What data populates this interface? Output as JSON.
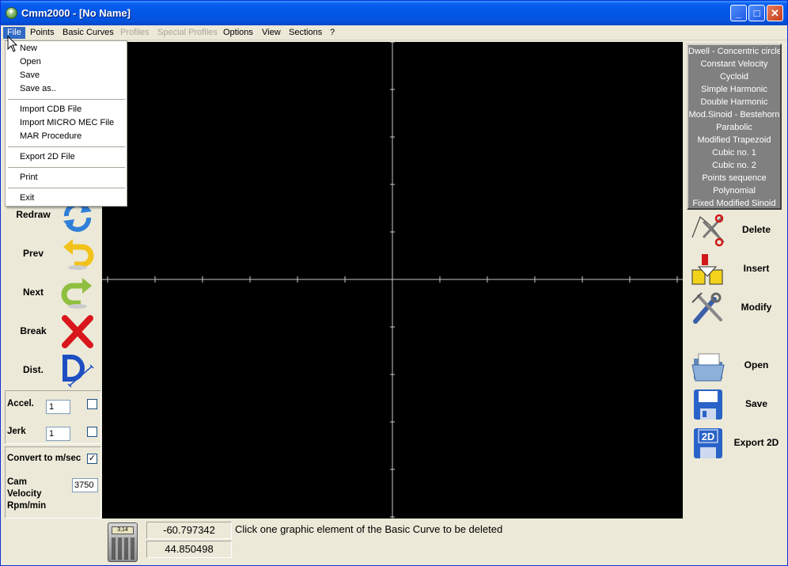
{
  "window": {
    "title": "Cmm2000 - [No Name]",
    "min": "_",
    "max": "□",
    "close": "✕"
  },
  "menu": {
    "file": "File",
    "points": "Points",
    "basic_curves": "Basic Curves",
    "profiles": "Profiles",
    "special_profiles": "Special Profiles",
    "options": "Options",
    "view": "View",
    "sections": "Sections",
    "help": "?"
  },
  "file_menu": {
    "new": "New",
    "open": "Open",
    "save": "Save",
    "save_as": "Save as..",
    "import_cdb": "Import CDB File",
    "import_micro_mec": "Import MICRO MEC File",
    "mar": "MAR Procedure",
    "export_2d": "Export 2D File",
    "print": "Print",
    "exit": "Exit"
  },
  "left_tools": {
    "redraw": "Redraw",
    "prev": "Prev",
    "next": "Next",
    "break": "Break",
    "dist": "Dist."
  },
  "params": {
    "accel_label": "Accel.",
    "accel_value": "1",
    "accel_checked": false,
    "jerk_label": "Jerk",
    "jerk_value": "1",
    "jerk_checked": false,
    "convert_label": "Convert to m/sec",
    "convert_checked": true,
    "convert_mark": "✓",
    "cam_velocity_label_1": "Cam",
    "cam_velocity_label_2": "Velocity",
    "cam_velocity_label_3": "Rpm/min",
    "cam_velocity_value": "3750"
  },
  "curves": [
    "Dwell - Concentric circle",
    "Constant Velocity",
    "Cycloid",
    "Simple Harmonic",
    "Double Harmonic",
    "Mod.Sinoid - Bestehorn",
    "Parabolic",
    "Modified Trapezoid",
    "Cubic no.  1",
    "Cubic no.  2",
    "Points sequence",
    "Polynomial",
    "Fixed Modified Sinoid"
  ],
  "right_tools": {
    "delete": "Delete",
    "insert": "Insert",
    "modify": "Modify",
    "open": "Open",
    "save": "Save",
    "export_2d": "Export 2D"
  },
  "status": {
    "calc_display": "3,14",
    "x_value": "-60.797342",
    "y_value": "44.850498",
    "message": "Click one graphic element of the Basic Curve to be deleted"
  },
  "colors": {
    "title_blue": "#0458e8",
    "canvas_bg": "#000000",
    "axis": "#c8c8c8",
    "menu_highlight": "#316ac5",
    "curve_list_bg": "#808080"
  }
}
